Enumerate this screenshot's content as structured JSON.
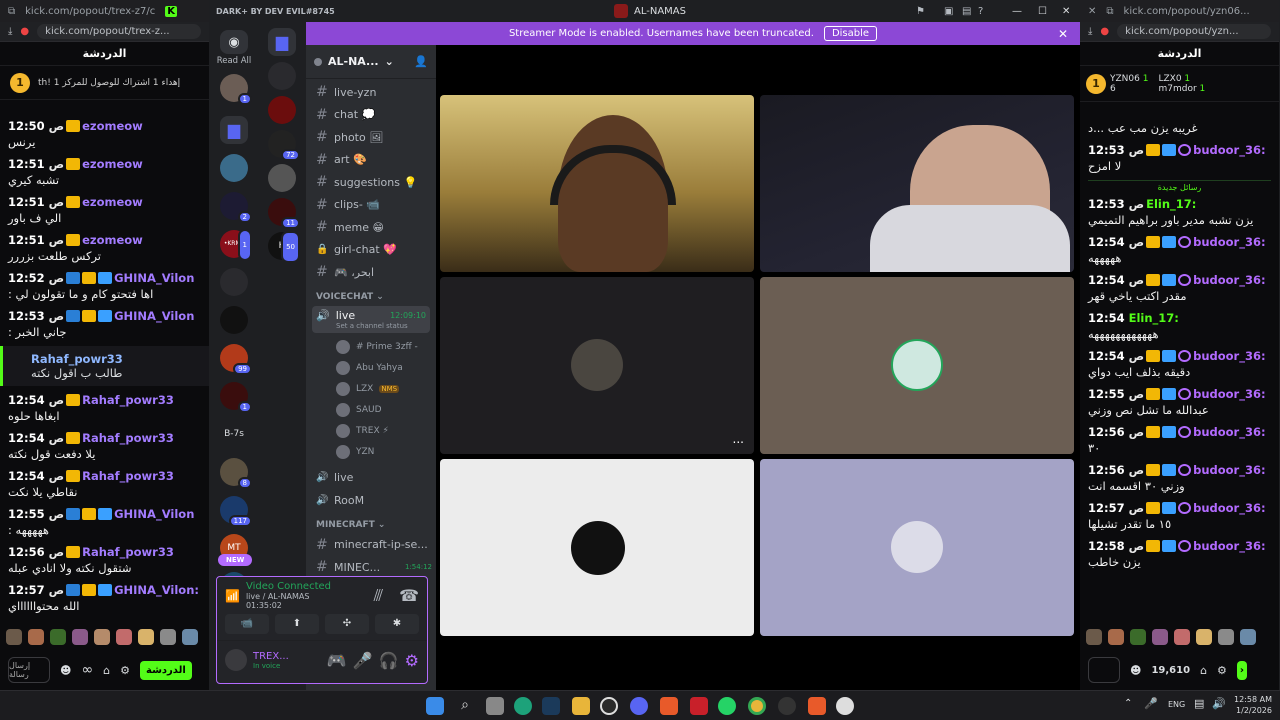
{
  "left_popout": {
    "tab_url": "kick.com/popout/trex-z7/c",
    "address": "kick.com/popout/trex-z...",
    "chat_title": "الدردشة",
    "pinned": {
      "badge": "1",
      "text": "إهداء 1 اشتراك للوصول للمركز 1 !th"
    },
    "messages": [
      {
        "time": "12:50",
        "ampm": "ص",
        "user": "ezomeow",
        "color": "#a37cff",
        "badges": [
          "crown"
        ],
        "text": "يرنس"
      },
      {
        "time": "12:51",
        "ampm": "ص",
        "user": "ezomeow",
        "color": "#a37cff",
        "badges": [
          "crown"
        ],
        "text": "تشبه كيري"
      },
      {
        "time": "12:51",
        "ampm": "ص",
        "user": "ezomeow",
        "color": "#a37cff",
        "badges": [
          "crown"
        ],
        "text": "الي ف باور"
      },
      {
        "time": "12:51",
        "ampm": "ص",
        "user": "ezomeow",
        "color": "#a37cff",
        "badges": [
          "crown"
        ],
        "text": "تركس طلعت بزررر"
      },
      {
        "time": "12:52",
        "ampm": "ص",
        "user": "GHINA_Vilon",
        "color": "#a37cff",
        "badges": [
          "sword",
          "crown",
          "gg"
        ],
        "text": "اها فتحتو كام و ما تقولون لي :"
      },
      {
        "time": "12:53",
        "ampm": "ص",
        "user": "GHINA_Vilon",
        "color": "#a37cff",
        "badges": [
          "sword",
          "crown",
          "gg"
        ],
        "text": "جاني الخبر :"
      }
    ],
    "highlight": {
      "user": "Rahaf_powr33",
      "text": "طالب ب اقول نكته"
    },
    "messages2": [
      {
        "time": "12:54",
        "ampm": "ص",
        "user": "Rahaf_powr33",
        "color": "#a37cff",
        "badges": [
          "crown"
        ],
        "text": "ابغاها حلوه"
      },
      {
        "time": "12:54",
        "ampm": "ص",
        "user": "Rahaf_powr33",
        "color": "#a37cff",
        "badges": [
          "crown"
        ],
        "text": "يلا دفعت قول نكته"
      },
      {
        "time": "12:54",
        "ampm": "ص",
        "user": "Rahaf_powr33",
        "color": "#a37cff",
        "badges": [
          "crown"
        ],
        "text": "نقاطي يلا نكت"
      },
      {
        "time": "12:55",
        "ampm": "ص",
        "user": "GHINA_Vilon",
        "color": "#a37cff",
        "badges": [
          "sword",
          "crown",
          "gg"
        ],
        "text": "هههههه :"
      },
      {
        "time": "12:56",
        "ampm": "ص",
        "user": "Rahaf_powr33",
        "color": "#a37cff",
        "badges": [
          "crown"
        ],
        "text": "شتقول نكته ولا انادي عبله"
      },
      {
        "time": "12:57",
        "ampm": "ص",
        "user": "GHINA_Vilon:",
        "color": "#a37cff",
        "badges": [
          "sword",
          "crown",
          "gg"
        ],
        "text": "الله محتوااااااي"
      }
    ],
    "input_hint": "إرسال رسالة",
    "send_label": "الدردشة",
    "points": "∞"
  },
  "right_popout": {
    "tab_url": "kick.com/popout/yzn06...",
    "address": "kick.com/popout/yzn...",
    "chat_title": "الدردشة",
    "top": [
      {
        "name": "YZN06",
        "count": "1"
      },
      {
        "name": "LZX0",
        "count": "1"
      },
      {
        "name": "6",
        "count": ""
      },
      {
        "name": "m7mdor",
        "count": "1"
      }
    ],
    "first_text": "غريبه يزن مب عب ...د",
    "messages": [
      {
        "time": "12:53",
        "ampm": "ص",
        "user": "budoor_36:",
        "color": "#b36bff",
        "badges": [
          "crown",
          "gg",
          "circ"
        ],
        "text": "لا امزح"
      },
      {
        "separator": "رسائل جديدة"
      },
      {
        "time": "12:53",
        "ampm": "ص",
        "user": "Elin_17:",
        "color": "#53fc18",
        "badges": [],
        "text": "يزن تشبه مدير باور براهيم التميمي"
      },
      {
        "time": "12:54",
        "ampm": "ص",
        "user": "budoor_36:",
        "color": "#b36bff",
        "badges": [
          "crown",
          "gg",
          "circ"
        ],
        "text": "هههههه"
      },
      {
        "time": "12:54",
        "ampm": "ص",
        "user": "budoor_36:",
        "color": "#b36bff",
        "badges": [
          "crown",
          "gg",
          "circ"
        ],
        "text": "مقدر اكتب ياخي قهر"
      },
      {
        "time": "12:54",
        "ampm": "",
        "user": "Elin_17:",
        "color": "#53fc18",
        "badges": [],
        "text": "ههههههههههههه"
      },
      {
        "time": "12:54",
        "ampm": "ص",
        "user": "budoor_36:",
        "color": "#b36bff",
        "badges": [
          "crown",
          "gg",
          "circ"
        ],
        "text": "دقيقه بذلف ايب دواي"
      },
      {
        "time": "12:55",
        "ampm": "ص",
        "user": "budoor_36:",
        "color": "#b36bff",
        "badges": [
          "crown",
          "gg",
          "circ"
        ],
        "text": "عبدالله ما تشل نص وزني"
      },
      {
        "time": "12:56",
        "ampm": "ص",
        "user": "budoor_36:",
        "color": "#b36bff",
        "badges": [
          "crown",
          "gg",
          "circ"
        ],
        "text": "٣٠"
      },
      {
        "time": "12:56",
        "ampm": "ص",
        "user": "budoor_36:",
        "color": "#b36bff",
        "badges": [
          "crown",
          "gg",
          "circ"
        ],
        "text": "وزني ٣٠ اقسمه انت"
      },
      {
        "time": "12:57",
        "ampm": "ص",
        "user": "budoor_36:",
        "color": "#b36bff",
        "badges": [
          "crown",
          "gg",
          "circ"
        ],
        "text": "١٥ ما تقدر تشيلها"
      },
      {
        "time": "12:58",
        "ampm": "ص",
        "user": "budoor_36:",
        "color": "#b36bff",
        "badges": [
          "crown",
          "gg",
          "circ"
        ],
        "text": "يزن خاطب"
      }
    ],
    "points": "19,610"
  },
  "discord": {
    "brand": "DARK+ BY DEV EVIL#8745",
    "window_title": "AL-NAMAS",
    "server_name": "AL-NA...",
    "banner_text": "Streamer Mode is enabled. Usernames have been truncated.",
    "banner_button": "Disable",
    "read_all": "Read All",
    "guild_label_b7s": "B-7s",
    "new_label": "NEW",
    "channels": [
      {
        "name": "live-yzn",
        "type": "text"
      },
      {
        "name": "chat 💭",
        "type": "text"
      },
      {
        "name": "photo 🖼",
        "type": "text"
      },
      {
        "name": "art 🎨",
        "type": "text"
      },
      {
        "name": "suggestions 💡",
        "type": "text"
      },
      {
        "name": "clips- 📹",
        "type": "text"
      },
      {
        "name": "meme 😁",
        "type": "text"
      },
      {
        "name": "girl-chat 💖",
        "type": "locked"
      },
      {
        "name": "🎮 ،ابحر",
        "type": "text"
      }
    ],
    "voice_category": "VOICECHAT",
    "live_channel": {
      "name": "live",
      "timer": "12:09:10",
      "status": "Set a channel status"
    },
    "voice_users": [
      {
        "name": "# Prime 3zff -"
      },
      {
        "name": "Abu Yahya"
      },
      {
        "name": "LZX",
        "tag": "NMS"
      },
      {
        "name": "SAUD"
      },
      {
        "name": "TREX ⚡"
      },
      {
        "name": "YZN"
      }
    ],
    "voice_channels": [
      "live",
      "RooM"
    ],
    "minecraft_category": "MINECRAFT",
    "minecraft_channels": [
      "minecraft-ip-se...",
      "MINEC..."
    ],
    "minecraft_timer": "1:54:12",
    "connection": {
      "title": "Video Connected",
      "subtitle": "live / AL-NAMAS",
      "time": "01:35:02"
    },
    "user": {
      "name": "TREX...",
      "status": "In voice"
    },
    "guild_badges": [
      "1",
      "2",
      "1",
      "99",
      "1",
      "8",
      "117"
    ],
    "folder_badges": [
      "72",
      "11",
      "50"
    ],
    "more": "..."
  },
  "taskbar": {
    "lang": "ENG",
    "time": "12:58 AM",
    "date": "1/2/2026"
  }
}
